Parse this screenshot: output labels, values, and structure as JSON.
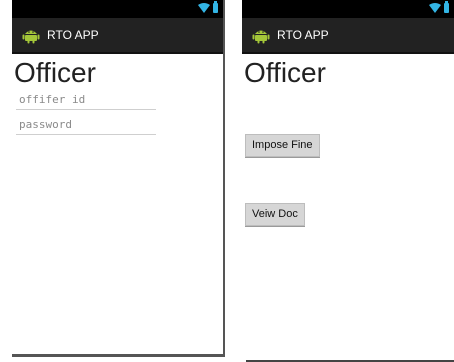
{
  "app": {
    "title": "RTO APP"
  },
  "login_screen": {
    "heading": "Officer",
    "officer_id_placeholder": "offifer id",
    "password_placeholder": "password"
  },
  "menu_screen": {
    "heading": "Officer",
    "impose_fine_label": "Impose Fine",
    "view_doc_label": "Veiw Doc"
  },
  "icons": {
    "app_icon": "android-icon",
    "wifi": "wifi-icon",
    "battery": "battery-icon"
  },
  "colors": {
    "statusbar": "#000000",
    "actionbar": "#222222",
    "accent": "#33b5e5",
    "android_green": "#a4c639",
    "button_bg": "#d6d6d6"
  }
}
